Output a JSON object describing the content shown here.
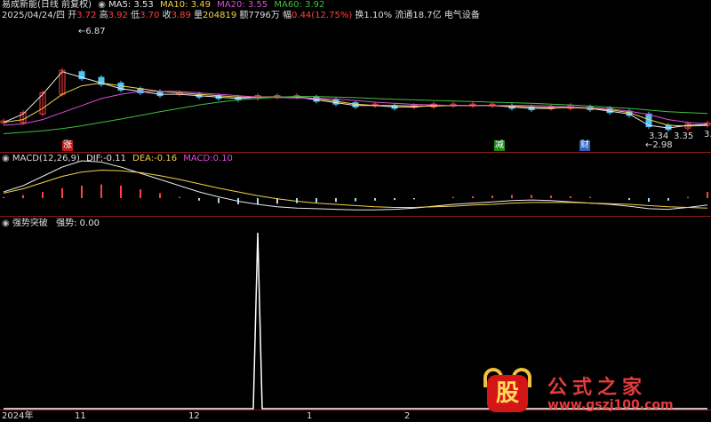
{
  "header": {
    "app_name": "易成新能(日线 前复权)",
    "ma5_label": "MA5:",
    "ma5_value": "3.53",
    "ma10_label": "MA10:",
    "ma10_value": "3.49",
    "ma20_label": "MA20:",
    "ma20_value": "3.55",
    "ma60_label": "MA60:",
    "ma60_value": "3.92",
    "quote_date": "2025/04/24/四",
    "open_label": "开",
    "open_value": "3.72",
    "high_label": "高",
    "high_value": "3.92",
    "low_label": "低",
    "low_value": "3.70",
    "close_label": "收",
    "close_value": "3.89",
    "vol_label": "量",
    "vol_value": "204819",
    "amount_label": "额",
    "amount_value": "7796万",
    "change_label": "幅",
    "change_value": "0.44(12.75%)",
    "turnover": "换1.10%",
    "float": "流通18.7亿",
    "sector": "电气设备"
  },
  "price_annotations": {
    "high_mark": "6.87",
    "low_mark": "2.98",
    "mark_a": "3.34",
    "mark_b": "3.35",
    "mark_c": "3."
  },
  "event_tags": [
    "涨",
    "减",
    "财"
  ],
  "macd": {
    "title": "MACD(12,26,9)",
    "dif_label": "DIF:",
    "dif_value": "-0.11",
    "dea_label": "DEA:",
    "dea_value": "-0.16",
    "macd_label": "MACD:",
    "macd_value": "0.10"
  },
  "indicator": {
    "title": "强势突破",
    "value_label": "强势:",
    "value": "0.00"
  },
  "x_axis": {
    "labels": [
      "2024年",
      "11",
      "12",
      "1",
      "2"
    ]
  },
  "logo": {
    "badge": "股",
    "text": "公式之家",
    "url": "www.gszj100.com"
  },
  "colors": {
    "ma5": "#e8e8e8",
    "ma10": "#f2d34a",
    "ma20": "#d94fd9",
    "ma60": "#3fbf3f",
    "up": "#ff4040",
    "down": "#4fc3f7",
    "separator": "#8b1a1a"
  },
  "chart_data": [
    {
      "type": "line",
      "title": "",
      "series": [
        {
          "name": "MA5",
          "values": [
            3.6,
            3.9,
            4.6,
            5.4,
            5.2,
            5.0,
            4.8,
            4.7,
            4.6,
            4.6,
            4.55,
            4.5,
            4.45,
            4.5,
            4.5,
            4.5,
            4.4,
            4.3,
            4.2,
            4.2,
            4.15,
            4.15,
            4.2,
            4.2,
            4.2,
            4.2,
            4.15,
            4.1,
            4.1,
            4.15,
            4.1,
            4.0,
            3.9,
            3.5,
            3.4,
            3.5,
            3.53
          ]
        },
        {
          "name": "MA10",
          "values": [
            3.6,
            3.7,
            4.1,
            4.6,
            4.9,
            5.0,
            4.9,
            4.8,
            4.7,
            4.65,
            4.6,
            4.55,
            4.5,
            4.5,
            4.5,
            4.5,
            4.45,
            4.35,
            4.25,
            4.2,
            4.2,
            4.18,
            4.18,
            4.2,
            4.2,
            4.2,
            4.18,
            4.15,
            4.12,
            4.12,
            4.1,
            4.05,
            3.95,
            3.7,
            3.5,
            3.47,
            3.49
          ]
        },
        {
          "name": "MA20",
          "values": [
            3.5,
            3.55,
            3.7,
            3.95,
            4.2,
            4.45,
            4.6,
            4.7,
            4.7,
            4.7,
            4.65,
            4.6,
            4.55,
            4.5,
            4.48,
            4.47,
            4.46,
            4.43,
            4.38,
            4.32,
            4.28,
            4.24,
            4.22,
            4.2,
            4.2,
            4.2,
            4.2,
            4.2,
            4.18,
            4.15,
            4.12,
            4.08,
            4.0,
            3.88,
            3.7,
            3.6,
            3.55
          ]
        },
        {
          "name": "MA60",
          "values": [
            3.2,
            3.25,
            3.3,
            3.38,
            3.48,
            3.6,
            3.72,
            3.85,
            3.98,
            4.1,
            4.22,
            4.32,
            4.4,
            4.45,
            4.5,
            4.52,
            4.52,
            4.5,
            4.48,
            4.45,
            4.42,
            4.4,
            4.38,
            4.36,
            4.34,
            4.32,
            4.3,
            4.28,
            4.25,
            4.22,
            4.18,
            4.14,
            4.1,
            4.04,
            3.98,
            3.95,
            3.92
          ]
        }
      ]
    },
    {
      "type": "bar",
      "title": "MACD(12,26,9)",
      "series": [
        {
          "name": "MACD",
          "values": [
            0.02,
            0.05,
            0.1,
            0.16,
            0.2,
            0.22,
            0.2,
            0.14,
            0.08,
            0.02,
            -0.04,
            -0.08,
            -0.1,
            -0.1,
            -0.09,
            -0.08,
            -0.07,
            -0.06,
            -0.05,
            -0.04,
            -0.03,
            -0.02,
            0.0,
            0.02,
            0.03,
            0.04,
            0.05,
            0.05,
            0.04,
            0.03,
            0.02,
            0.0,
            -0.03,
            -0.06,
            -0.04,
            0.02,
            0.1
          ]
        },
        {
          "name": "DIF",
          "values": [
            0.1,
            0.2,
            0.35,
            0.5,
            0.6,
            0.58,
            0.5,
            0.4,
            0.3,
            0.2,
            0.1,
            0.02,
            -0.05,
            -0.1,
            -0.14,
            -0.16,
            -0.17,
            -0.18,
            -0.19,
            -0.19,
            -0.18,
            -0.16,
            -0.13,
            -0.1,
            -0.08,
            -0.06,
            -0.04,
            -0.03,
            -0.04,
            -0.06,
            -0.08,
            -0.1,
            -0.13,
            -0.17,
            -0.18,
            -0.15,
            -0.11
          ]
        },
        {
          "name": "DEA",
          "values": [
            0.08,
            0.15,
            0.25,
            0.35,
            0.42,
            0.45,
            0.44,
            0.41,
            0.36,
            0.3,
            0.23,
            0.16,
            0.1,
            0.04,
            -0.01,
            -0.05,
            -0.08,
            -0.1,
            -0.12,
            -0.14,
            -0.15,
            -0.15,
            -0.14,
            -0.13,
            -0.11,
            -0.1,
            -0.08,
            -0.07,
            -0.07,
            -0.07,
            -0.08,
            -0.09,
            -0.1,
            -0.12,
            -0.14,
            -0.15,
            -0.16
          ]
        }
      ]
    },
    {
      "type": "line",
      "title": "强势突破",
      "series": [
        {
          "name": "强势",
          "values": [
            0,
            0,
            0,
            0,
            0,
            0,
            0,
            0,
            0,
            0,
            0,
            0,
            0,
            1,
            0,
            0,
            0,
            0,
            0,
            0,
            0,
            0,
            0,
            0,
            0,
            0,
            0,
            0,
            0,
            0,
            0,
            0,
            0,
            0,
            0,
            0,
            0
          ]
        }
      ]
    }
  ]
}
